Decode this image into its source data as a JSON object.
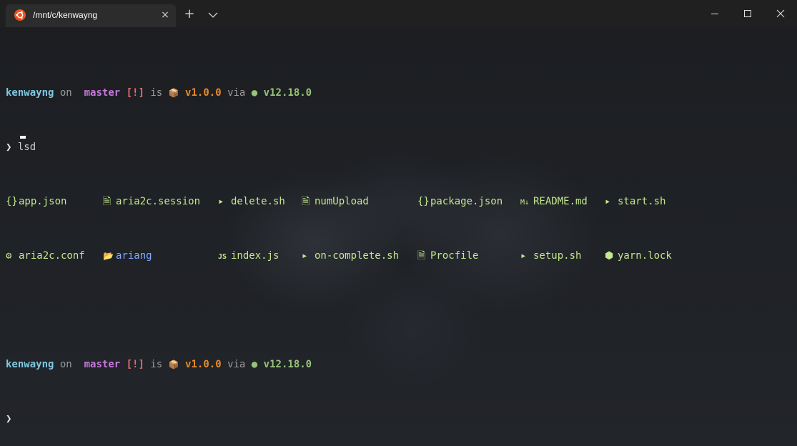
{
  "tab": {
    "title": "/mnt/c/kenwayng",
    "icon": "ubuntu-icon",
    "close_icon": "×"
  },
  "titlebar": {
    "new_tab_label": "+",
    "dropdown_icon": "chevron-down-icon",
    "minimize_icon": "minimize-icon",
    "maximize_icon": "maximize-icon",
    "close_icon": "close-icon"
  },
  "prompt": {
    "user": "kenwayng",
    "on": "on",
    "branch_icon": "",
    "branch": "master",
    "git_status": "[!]",
    "is": "is",
    "package_icon": "📦",
    "package_version": "v1.0.0",
    "via": "via",
    "node_icon": "●",
    "node_version": "v12.18.0",
    "symbol": "❯"
  },
  "command": "lsd",
  "files": [
    {
      "icon": "{}",
      "name": "app.json",
      "kind": "file"
    },
    {
      "icon": "🗎",
      "name": "aria2c.session",
      "kind": "file"
    },
    {
      "icon": "▸",
      "name": "delete.sh",
      "kind": "file"
    },
    {
      "icon": "🗎",
      "name": "numUpload",
      "kind": "file"
    },
    {
      "icon": "{}",
      "name": "package.json",
      "kind": "file"
    },
    {
      "icon": "M↓",
      "name": "README.md",
      "kind": "file"
    },
    {
      "icon": "▸",
      "name": "start.sh",
      "kind": "file"
    },
    {
      "icon": "⚙",
      "name": "aria2c.conf",
      "kind": "file"
    },
    {
      "icon": "📂",
      "name": "ariang",
      "kind": "dir"
    },
    {
      "icon": "JS",
      "name": "index.js",
      "kind": "file"
    },
    {
      "icon": "▸",
      "name": "on-complete.sh",
      "kind": "file"
    },
    {
      "icon": "🗎",
      "name": "Procfile",
      "kind": "file"
    },
    {
      "icon": "▸",
      "name": "setup.sh",
      "kind": "file"
    },
    {
      "icon": "⬢",
      "name": "yarn.lock",
      "kind": "file"
    }
  ],
  "colors": {
    "user": "#7ec8e3",
    "branch": "#c678dd",
    "status": "#e06c75",
    "package": "#e58a2c",
    "node": "#98c379",
    "file": "#c3e88d",
    "dir": "#82aaff"
  }
}
